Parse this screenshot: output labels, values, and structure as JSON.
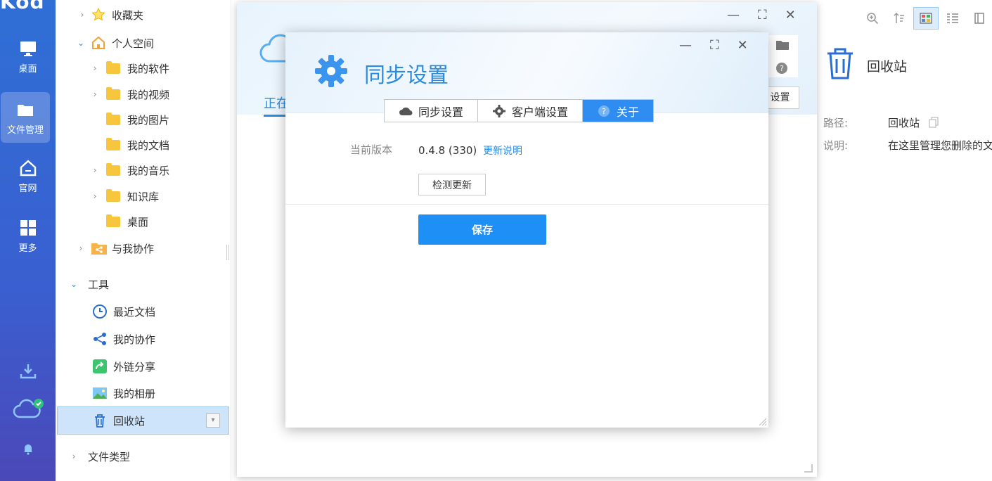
{
  "rail": {
    "brand": "Kod",
    "items": [
      {
        "label": "桌面",
        "icon": "monitor-icon"
      },
      {
        "label": "文件管理",
        "icon": "folder-icon"
      },
      {
        "label": "官网",
        "icon": "home-icon"
      },
      {
        "label": "更多",
        "icon": "grid-icon"
      }
    ],
    "bottom_icons": [
      "download-icon",
      "cloud-sync-icon",
      "bell-icon"
    ]
  },
  "tree": {
    "favorites": "收藏夹",
    "personal": "个人空间",
    "folders": [
      "我的软件",
      "我的视频",
      "我的图片",
      "我的文档",
      "我的音乐",
      "知识库",
      "桌面"
    ],
    "share": "与我协作",
    "tools_header": "工具",
    "tools": [
      "最近文档",
      "我的协作",
      "外链分享",
      "我的相册",
      "回收站"
    ],
    "file_types": "文件类型"
  },
  "right_panel": {
    "title": "回收站",
    "path_label": "路径:",
    "path_value": "回收站",
    "desc_label": "说明:",
    "desc_value": "在这里管理您删除的文"
  },
  "outer_window": {
    "tab_label": "正在",
    "settings_button": "设置"
  },
  "dialog": {
    "title": "同步设置",
    "tabs": [
      "同步设置",
      "客户端设置",
      "关于"
    ],
    "active_tab": "关于",
    "version_label": "当前版本",
    "version_value": "0.4.8 (330)",
    "changelog_link": "更新说明",
    "check_update_button": "检测更新",
    "save_button": "保存"
  },
  "colors": {
    "accent": "#2a8be0",
    "save_button": "#1e90f5",
    "active_tab": "#2f8cf0",
    "rail_top": "#2f6fd6",
    "rail_bottom": "#4b48b8"
  }
}
